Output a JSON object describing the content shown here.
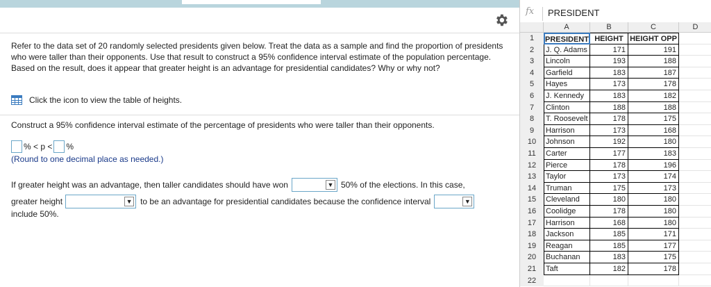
{
  "question": {
    "paragraph": "Refer to the data set of 20 randomly selected presidents given below. Treat the data as a sample and find the proportion of presidents who were taller than their opponents. Use that result to construct a 95% confidence interval estimate of the population percentage. Based on the result, does it appear that greater height is an advantage for presidential candidates? Why or why not?",
    "icon_prompt": "Click the icon to view the table of heights.",
    "construct": "Construct a 95% confidence interval estimate of the percentage of presidents who were taller than their opponents.",
    "ci_mid": "% < p <",
    "ci_end": "%",
    "round_note": "(Round to one decimal place as needed.)",
    "sentence1_pre": "If greater height was an advantage, then taller candidates should have won",
    "sentence1_post": "50% of the elections. In this case,",
    "sentence2_pre": "greater height",
    "sentence2_mid": "to be an advantage for presidential candidates because the confidence interval",
    "sentence3": "include 50%.",
    "dropdown_arrow": "▼"
  },
  "spreadsheet": {
    "fx_label": "fx",
    "formula_value": "PRESIDENT",
    "columns": [
      "A",
      "B",
      "C",
      "D"
    ],
    "header": {
      "row": "1",
      "a": "PRESIDENT",
      "b": "HEIGHT",
      "c": "HEIGHT OPP"
    },
    "rows": [
      {
        "n": "2",
        "a": "J. Q. Adams",
        "b": "171",
        "c": "191"
      },
      {
        "n": "3",
        "a": "Lincoln",
        "b": "193",
        "c": "188"
      },
      {
        "n": "4",
        "a": "Garfield",
        "b": "183",
        "c": "187"
      },
      {
        "n": "5",
        "a": "Hayes",
        "b": "173",
        "c": "178"
      },
      {
        "n": "6",
        "a": "J. Kennedy",
        "b": "183",
        "c": "182"
      },
      {
        "n": "7",
        "a": "Clinton",
        "b": "188",
        "c": "188"
      },
      {
        "n": "8",
        "a": "T. Roosevelt",
        "b": "178",
        "c": "175"
      },
      {
        "n": "9",
        "a": "Harrison",
        "b": "173",
        "c": "168"
      },
      {
        "n": "10",
        "a": "Johnson",
        "b": "192",
        "c": "180"
      },
      {
        "n": "11",
        "a": "Carter",
        "b": "177",
        "c": "183"
      },
      {
        "n": "12",
        "a": "Pierce",
        "b": "178",
        "c": "196"
      },
      {
        "n": "13",
        "a": "Taylor",
        "b": "173",
        "c": "174"
      },
      {
        "n": "14",
        "a": "Truman",
        "b": "175",
        "c": "173"
      },
      {
        "n": "15",
        "a": "Cleveland",
        "b": "180",
        "c": "180"
      },
      {
        "n": "16",
        "a": "Coolidge",
        "b": "178",
        "c": "180"
      },
      {
        "n": "17",
        "a": "Harrison",
        "b": "168",
        "c": "180"
      },
      {
        "n": "18",
        "a": "Jackson",
        "b": "185",
        "c": "171"
      },
      {
        "n": "19",
        "a": "Reagan",
        "b": "185",
        "c": "177"
      },
      {
        "n": "20",
        "a": "Buchanan",
        "b": "183",
        "c": "175"
      },
      {
        "n": "21",
        "a": "Taft",
        "b": "182",
        "c": "178"
      }
    ],
    "empty_row": "22"
  }
}
